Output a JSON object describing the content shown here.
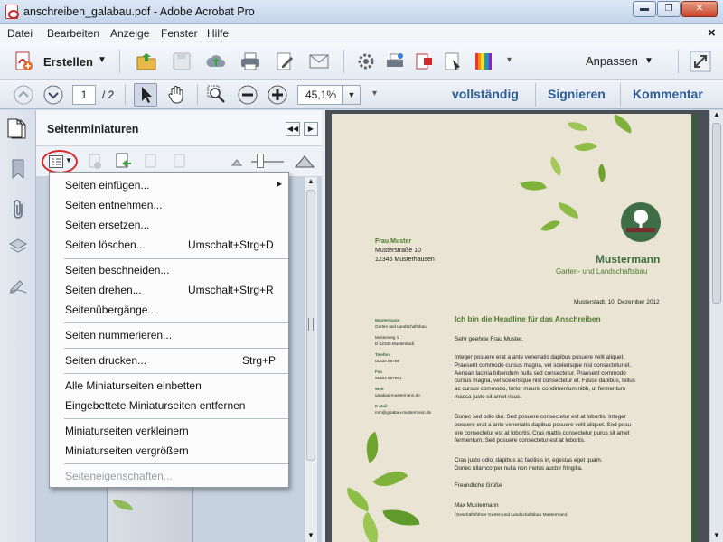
{
  "window": {
    "title": "anschreiben_galabau.pdf - Adobe Acrobat Pro",
    "minimize": "▬",
    "restore": "❐",
    "close": "✕"
  },
  "menubar": {
    "items": [
      "Datei",
      "Bearbeiten",
      "Anzeige",
      "Fenster",
      "Hilfe"
    ],
    "close": "×"
  },
  "toolbar1": {
    "create_label": "Erstellen",
    "customize_label": "Anpassen"
  },
  "toolbar2": {
    "page_current": "1",
    "page_total": "/ 2",
    "zoom_value": "45,1%",
    "full_label": "vollständig",
    "sign_label": "Signieren",
    "comment_label": "Kommentar"
  },
  "panel": {
    "title": "Seitenminiaturen"
  },
  "context_menu": {
    "items": [
      {
        "label": "Seiten einfügen...",
        "shortcut": "",
        "submenu": true
      },
      {
        "label": "Seiten entnehmen...",
        "shortcut": ""
      },
      {
        "label": "Seiten ersetzen...",
        "shortcut": ""
      },
      {
        "label": "Seiten löschen...",
        "shortcut": "Umschalt+Strg+D"
      },
      {
        "label": "Seiten beschneiden...",
        "shortcut": ""
      },
      {
        "label": "Seiten drehen...",
        "shortcut": "Umschalt+Strg+R"
      },
      {
        "label": "Seitenübergänge...",
        "shortcut": ""
      },
      {
        "label": "Seiten nummerieren...",
        "shortcut": ""
      },
      {
        "label": "Seiten drucken...",
        "shortcut": "Strg+P"
      },
      {
        "label": "Alle Miniaturseiten einbetten",
        "shortcut": ""
      },
      {
        "label": "Eingebettete Miniaturseiten entfernen",
        "shortcut": ""
      },
      {
        "label": "Miniaturseiten verkleinern",
        "shortcut": ""
      },
      {
        "label": "Miniaturseiten vergrößern",
        "shortcut": ""
      },
      {
        "label": "Seiteneigenschaften...",
        "shortcut": "",
        "disabled": true
      }
    ]
  },
  "document": {
    "recipient_name": "Frau Muster",
    "recipient_street": "Musterstraße 10",
    "recipient_city": "12345 Musterhausen",
    "company_name": "Mustermann",
    "company_sub": "Garten- und Landschaftsbau",
    "date_line": "Musterstadt, 10. Dezember 2012",
    "sidebar_name": "Mustermann",
    "sidebar_sub": "Garten und Landschaftsbau",
    "sidebar_street": "Musterweg 1",
    "sidebar_city": "D-12345 Musterstadt",
    "tel_label": "Telefon",
    "tel_value": "01234 56789",
    "fax_label": "Fax",
    "fax_value": "01234 567891",
    "web_label": "Web",
    "web_value": "galabau-mustermann.de",
    "mail_label": "E-Mail",
    "mail_value": "mm@galabau-mustermann.de",
    "headline": "Ich bin die Headline für das Anschreiben",
    "salutation": "Sehr geehrte Frau Muster,",
    "para1": [
      "Integer posuere erat a ante venenatis dapibus posuere velit aliquet.",
      "Praesent commodo cursus magna, vel scelerisque nisl consectetur et.",
      "Aenean lacinia bibendum nulla sed consectetur. Praesent commodo",
      "cursus magna, vel scelerisque nisl consectetur et. Fusce dapibus, tellus",
      "ac cursus commodo, tortor mauris condimentum nibh, ut fermentum",
      "massa justo sit amet risus."
    ],
    "para2": [
      "Donec sed odio dui. Sed posuere consectetur est at lobortis. Integer",
      "posuere erat a ante venenatis dapibus posuere velit aliquet. Sed posu-",
      "ere consectetur est at lobortis.  Cras mattis consectetur purus sit amet",
      "fermentum. Sed posuere consectetur est at lobortis."
    ],
    "para3": [
      "Cras justo odio, dapibus ac facilisis in, egestas eget quam.",
      "Donec ullamcorper nulla non metus auctor fringilla."
    ],
    "closing": "Freundliche Grüße",
    "signer": "Max Mustermann",
    "signer_title": "(Geschäftsführer Garten und Landschaftsbau Mustermann)"
  }
}
